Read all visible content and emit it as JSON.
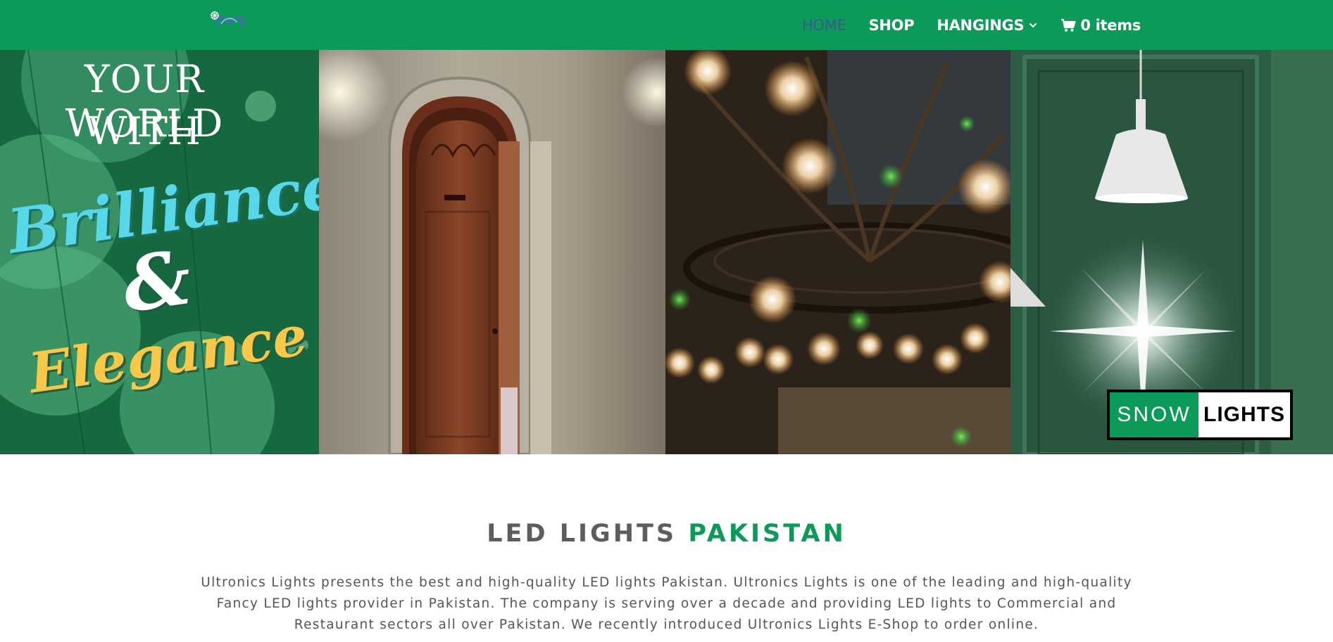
{
  "header": {
    "logo_alt": "SNOW",
    "nav": {
      "home": "HOME",
      "shop": "SHOP",
      "hangings": "HANGINGS",
      "cart": "0 items"
    }
  },
  "hero": {
    "headline": {
      "line1": "YOUR WORLD",
      "line2": "WITH",
      "word1": "Brilliance",
      "amp": "&",
      "word2": "Elegance"
    },
    "badge": {
      "left": "SNOW",
      "right": "LIGHTS"
    },
    "slides_count": 4,
    "active_slide": 3
  },
  "content": {
    "title_part1": "LED LIGHTS",
    "title_part2": "PAKISTAN",
    "intro": "Ultronics Lights presents the best and high-quality LED lights Pakistan. Ultronics Lights is one of the leading and high-quality Fancy LED lights provider in Pakistan. The company is serving over a decade and providing LED lights to Commercial and Restaurant sectors all over Pakistan. We recently introduced Ultronics Lights E-Shop to order online."
  },
  "colors": {
    "brand_green": "#0b9a58",
    "active_nav": "#3a5a8c",
    "title_grey": "#5d5d5d"
  },
  "icons": [
    "snow-logo",
    "chevron-down-icon",
    "cart-icon"
  ]
}
